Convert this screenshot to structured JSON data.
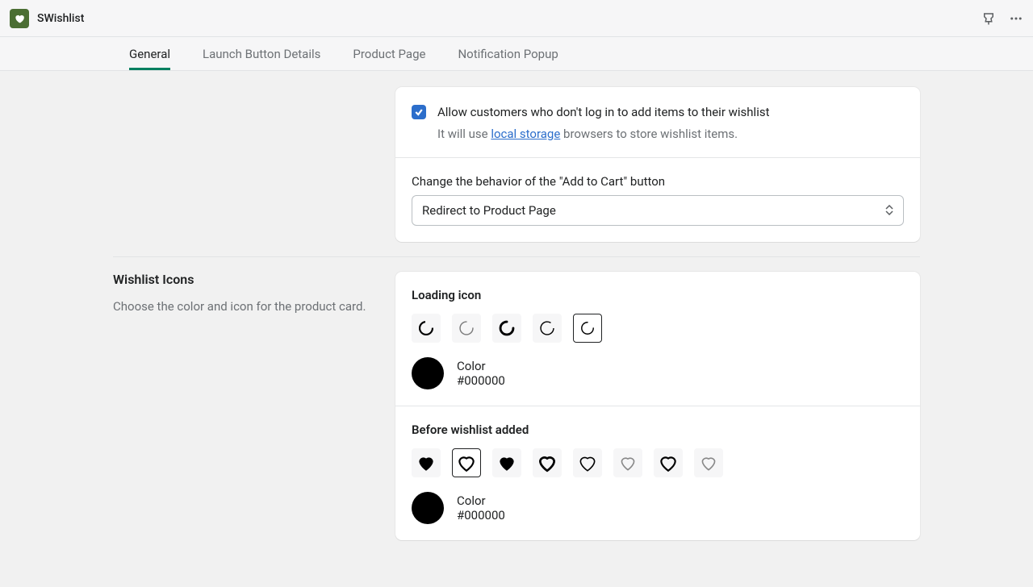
{
  "header": {
    "app_name": "SWishlist"
  },
  "tabs": {
    "general": "General",
    "launch": "Launch Button Details",
    "product": "Product Page",
    "popup": "Notification Popup",
    "active": "general"
  },
  "settings": {
    "allow_guest_label": "Allow customers who don't log in to add items to their wishlist",
    "allow_guest_help_prefix": "It will use ",
    "allow_guest_help_link": "local storage",
    "allow_guest_help_suffix": " browsers to store wishlist items.",
    "atc_label": "Change the behavior of the \"Add to Cart\" button",
    "atc_value": "Redirect to Product Page"
  },
  "icons": {
    "section_title": "Wishlist Icons",
    "section_desc": "Choose the color and icon for the product card.",
    "loading_heading": "Loading icon",
    "before_heading": "Before wishlist added",
    "color_label": "Color",
    "loading_color": "#000000",
    "before_color": "#000000"
  }
}
